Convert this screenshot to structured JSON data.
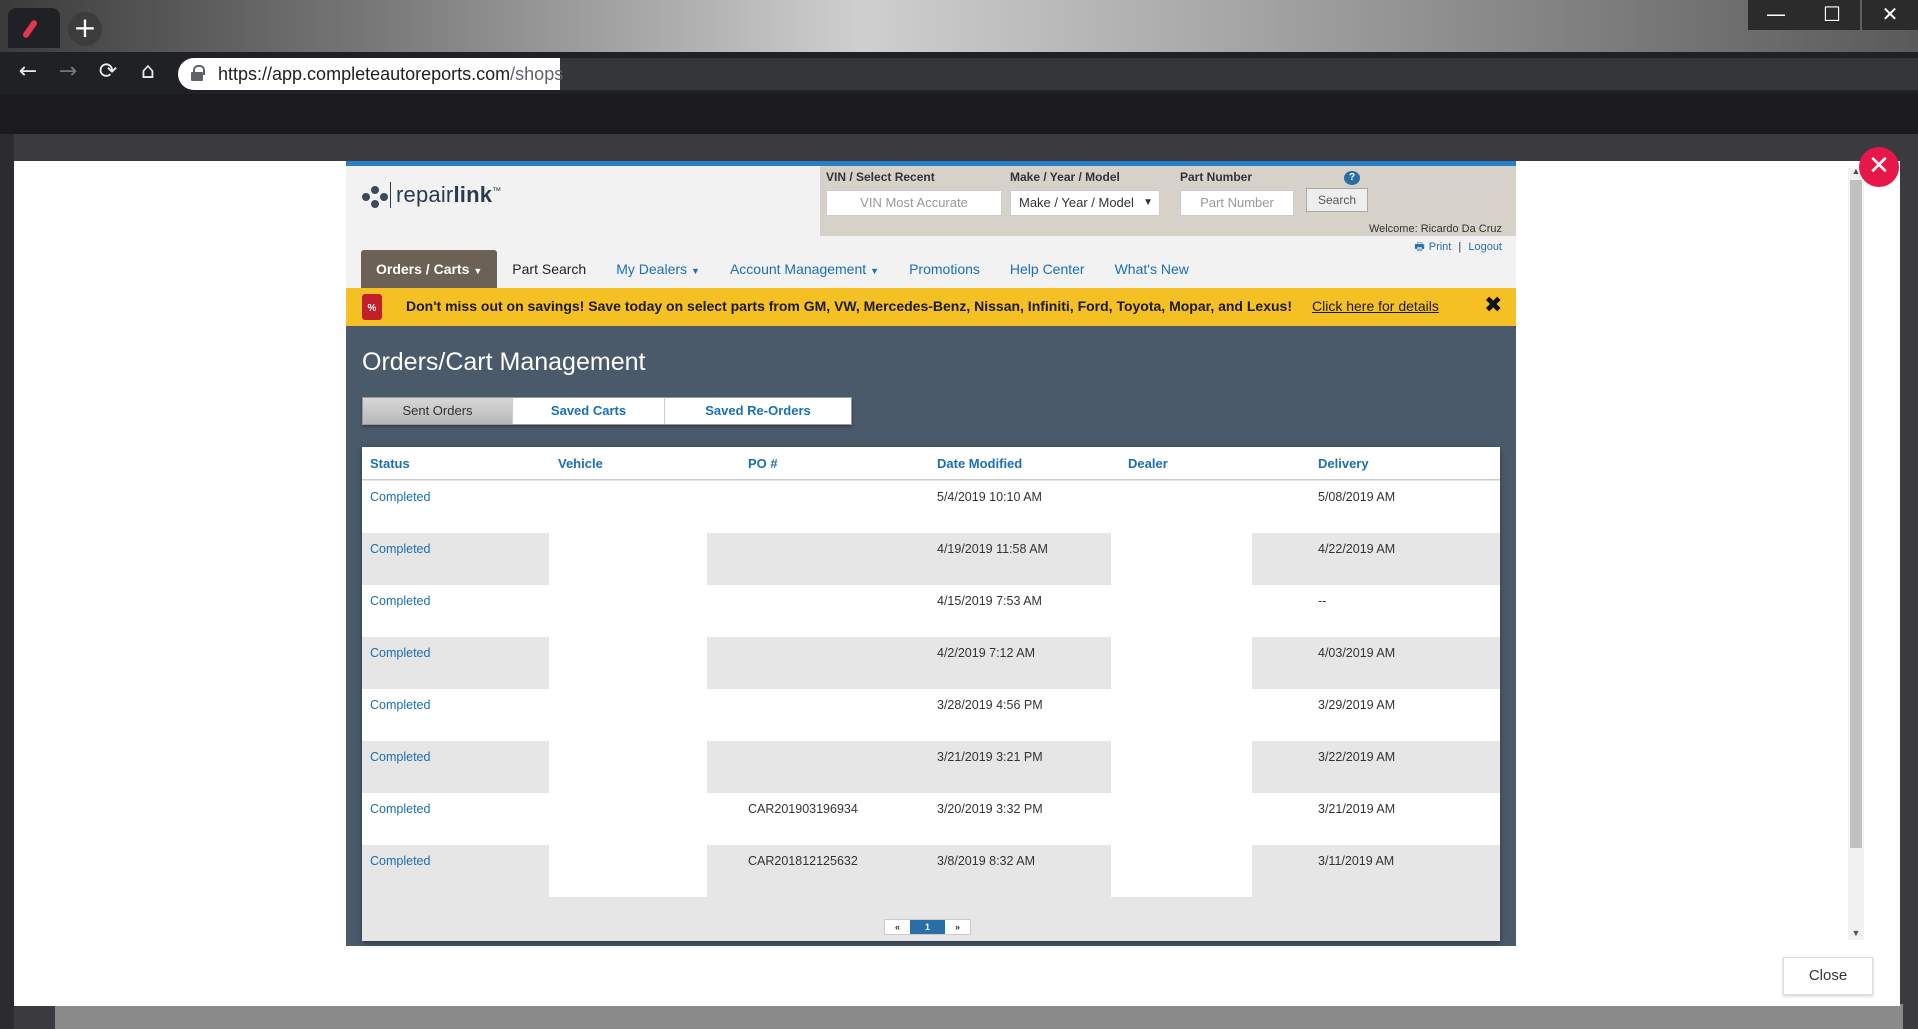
{
  "browser": {
    "url_host": "https://app.completeautoreports.com",
    "url_path": "/shops",
    "new_tab_symbol": "+",
    "nav_back": "←",
    "nav_forward": "→",
    "nav_reload": "⟳",
    "nav_home": "⌂",
    "win_minimize": "—",
    "win_maximize": "☐",
    "win_close": "✕"
  },
  "modal": {
    "close_x": "✕",
    "close_button": "Close"
  },
  "app": {
    "logo": {
      "part1": "repair",
      "part2": "link",
      "tm": "™"
    },
    "search": {
      "vin_label": "VIN / Select Recent",
      "vin_placeholder": "VIN Most Accurate",
      "mym_label": "Make / Year / Model",
      "mym_value": "Make / Year / Model",
      "part_label": "Part Number",
      "part_placeholder": "Part Number",
      "help": "?",
      "search_button": "Search"
    },
    "welcome": "Welcome: Ricardo Da Cruz",
    "print": "Print",
    "separator": "|",
    "logout": "Logout",
    "nav": [
      {
        "label": "Orders / Carts",
        "caret": true
      },
      {
        "label": "Part Search",
        "caret": false
      },
      {
        "label": "My Dealers",
        "caret": true
      },
      {
        "label": "Account Management",
        "caret": true
      },
      {
        "label": "Promotions",
        "caret": false
      },
      {
        "label": "Help Center",
        "caret": false
      },
      {
        "label": "What's New",
        "caret": false
      }
    ],
    "promo": {
      "icon_text": "%",
      "text": "Don't miss out on savings! Save today on select parts from GM, VW, Mercedes-Benz, Nissan, Infiniti, Ford, Toyota, Mopar, and Lexus!",
      "link": "Click here for details",
      "close": "✖"
    },
    "page_title": "Orders/Cart Management",
    "tabs": [
      "Sent Orders",
      "Saved Carts",
      "Saved Re-Orders"
    ],
    "active_tab": "Sent Orders",
    "table": {
      "headers": [
        "Status",
        "Vehicle",
        "PO #",
        "Date Modified",
        "Dealer",
        "Delivery"
      ],
      "rows": [
        {
          "status": "Completed",
          "vehicle": "",
          "po": "",
          "date": "5/4/2019 10:10 AM",
          "dealer": "",
          "delivery": "5/08/2019 AM"
        },
        {
          "status": "Completed",
          "vehicle": "",
          "po": "",
          "date": "4/19/2019 11:58 AM",
          "dealer": "",
          "delivery": "4/22/2019 AM"
        },
        {
          "status": "Completed",
          "vehicle": "",
          "po": "",
          "date": "4/15/2019 7:53 AM",
          "dealer": "",
          "delivery": "--"
        },
        {
          "status": "Completed",
          "vehicle": "",
          "po": "",
          "date": "4/2/2019 7:12 AM",
          "dealer": "",
          "delivery": "4/03/2019 AM"
        },
        {
          "status": "Completed",
          "vehicle": "",
          "po": "",
          "date": "3/28/2019 4:56 PM",
          "dealer": "",
          "delivery": "3/29/2019 AM"
        },
        {
          "status": "Completed",
          "vehicle": "",
          "po": "",
          "date": "3/21/2019 3:21 PM",
          "dealer": "",
          "delivery": "3/22/2019 AM"
        },
        {
          "status": "Completed",
          "vehicle": "",
          "po": "CAR201903196934",
          "date": "3/20/2019 3:32 PM",
          "dealer": "",
          "delivery": "3/21/2019 AM"
        },
        {
          "status": "Completed",
          "vehicle": "",
          "po": "CAR201812125632",
          "date": "3/8/2019 8:32 AM",
          "dealer": "",
          "delivery": "3/11/2019 AM"
        }
      ]
    },
    "pager": {
      "prev": "«",
      "current": "1",
      "next": "»"
    }
  }
}
